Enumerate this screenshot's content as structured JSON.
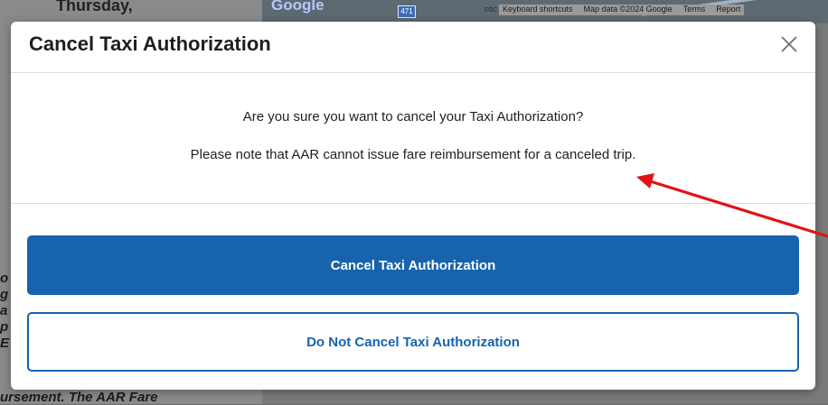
{
  "background": {
    "day_label": "Thursday,",
    "map": {
      "logo_text": "Google",
      "shield_text": "471",
      "attribution_prefix": "ntic",
      "attribution": [
        "Keyboard shortcuts",
        "Map data ©2024 Google",
        "Terms",
        "Report"
      ]
    },
    "left_fragments": "o\ng\na\np\nE",
    "bottom_fragment": "ursement. The AAR Fare"
  },
  "modal": {
    "title": "Cancel Taxi Authorization",
    "close_icon": "close-icon",
    "message_primary": "Are you sure you want to cancel your Taxi Authorization?",
    "message_note": "Please note that AAR cannot issue fare reimbursement for a canceled trip.",
    "confirm_button_label": "Cancel Taxi Authorization",
    "decline_button_label": "Do Not Cancel Taxi Authorization"
  },
  "colors": {
    "primary": "#1763ad",
    "annotation_arrow": "#e0141a",
    "overlay": "#7a7a7a"
  }
}
